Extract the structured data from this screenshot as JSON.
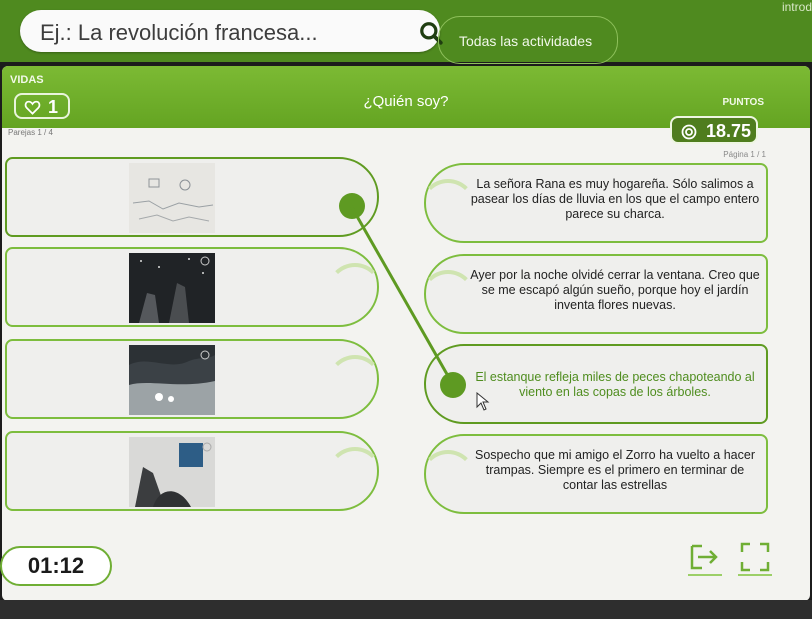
{
  "search": {
    "placeholder": "Ej.: La revolución francesa...",
    "icon": "search-icon"
  },
  "nav": {
    "activities_label": "Todas las actividades",
    "corner_text": "introd"
  },
  "game": {
    "title": "¿Quién soy?",
    "lives_label": "VIDAS",
    "lives": "1",
    "points_label": "PUNTOS",
    "points": "18.75",
    "pairs_label": "Parejas 1 / 4",
    "page_label": "Página 1 / 1",
    "timer": "01:12"
  },
  "cards": {
    "right": [
      {
        "text": "La señora Rana es muy hogareña. Sólo salimos a pasear los días de lluvia en los que el campo entero parece su charca."
      },
      {
        "text": "Ayer por la noche olvidé cerrar la ventana. Creo que se me escapó algún sueño, porque hoy el jardín inventa flores nuevas."
      },
      {
        "text": "El estanque refleja miles de peces chapoteando al viento en las copas de los árboles."
      },
      {
        "text": "Sospecho que mi amigo el Zorro ha vuelto a hacer trampas. Siempre es el primero en terminar de contar las estrellas"
      }
    ]
  },
  "colors": {
    "brand": "#64a422",
    "accent": "#5e9a22",
    "dark": "#4f7d1e"
  }
}
